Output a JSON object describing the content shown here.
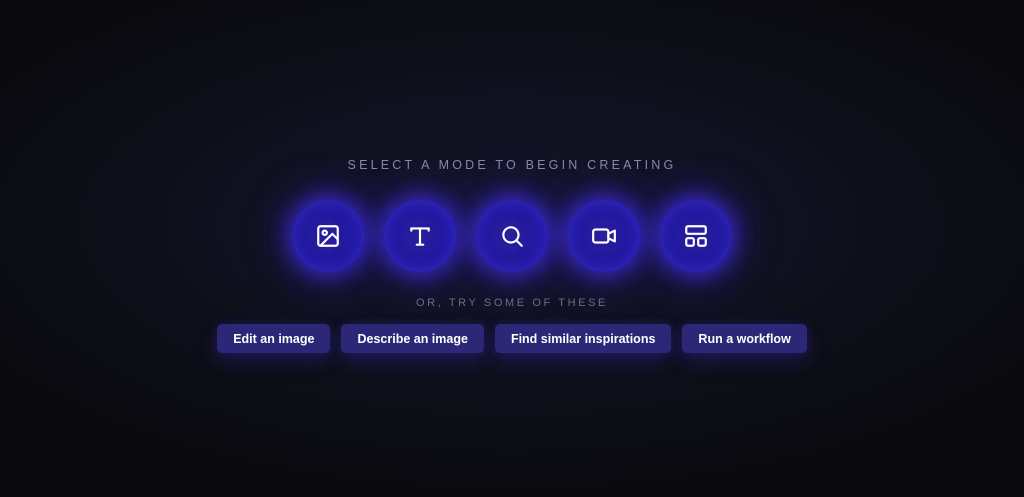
{
  "header": {
    "title": "SELECT A MODE TO BEGIN CREATING"
  },
  "modes": [
    {
      "icon": "image-icon"
    },
    {
      "icon": "text-icon"
    },
    {
      "icon": "search-icon"
    },
    {
      "icon": "video-icon"
    },
    {
      "icon": "layout-icon"
    }
  ],
  "suggestions": {
    "heading": "OR, TRY SOME OF THESE",
    "items": [
      {
        "label": "Edit an image"
      },
      {
        "label": "Describe an image"
      },
      {
        "label": "Find similar inspirations"
      },
      {
        "label": "Run a workflow"
      }
    ]
  },
  "colors": {
    "background": "#111120",
    "accent_glow": "#4632ff",
    "chip_bg": "#2c2776",
    "title_text": "#8a8aa6"
  }
}
